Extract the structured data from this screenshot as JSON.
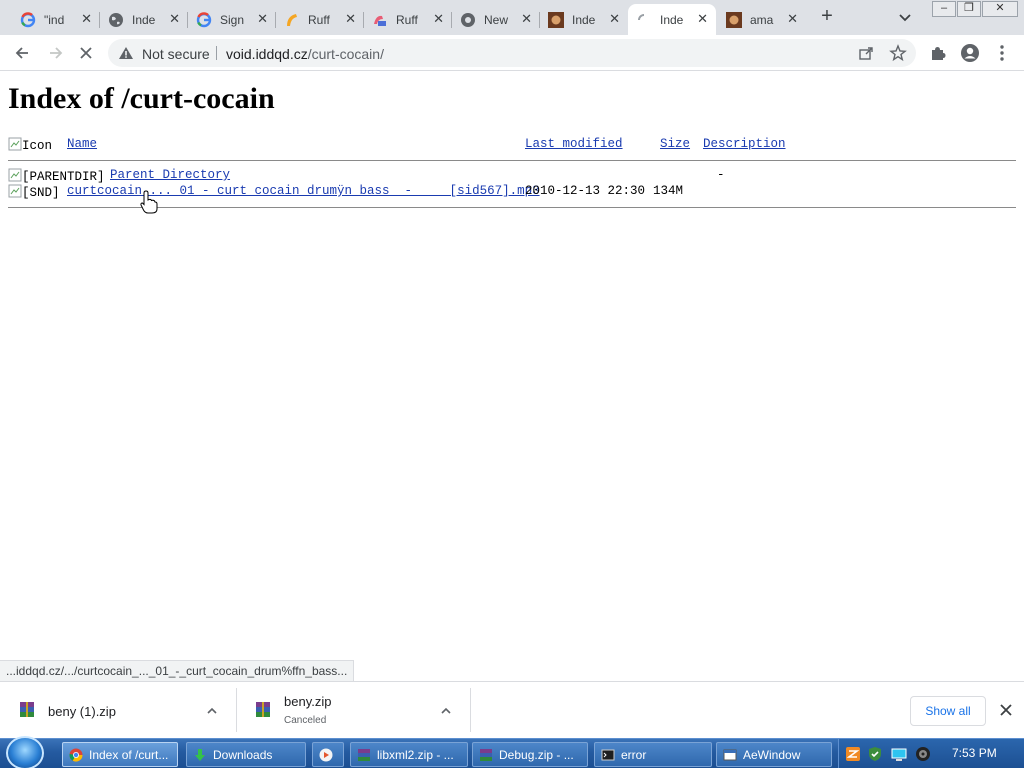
{
  "browser": {
    "tabs": [
      {
        "title": "\"ind",
        "icon": "google-icon"
      },
      {
        "title": "Inde",
        "icon": "globe-icon"
      },
      {
        "title": "Sign",
        "icon": "google-icon"
      },
      {
        "title": "Ruff",
        "icon": "ruffle-icon"
      },
      {
        "title": "Ruff",
        "icon": "ruffle-icon"
      },
      {
        "title": "New",
        "icon": "chrome-icon"
      },
      {
        "title": "Inde",
        "icon": "avatar-icon"
      },
      {
        "title": "Inde",
        "icon": "loading-spinner-icon",
        "active": true
      },
      {
        "title": "ama",
        "icon": "avatar-icon"
      }
    ],
    "security_label": "Not secure",
    "url_host": "void.iddqd.cz",
    "url_path": "/curt-cocain/"
  },
  "page": {
    "heading": "Index of /curt-cocain",
    "columns": {
      "icon_alt": "Icon",
      "name": "Name",
      "last_modified": "Last modified",
      "size": "Size",
      "description": "Description"
    },
    "rows": [
      {
        "icon_alt": "[PARENTDIR]",
        "name": "Parent Directory",
        "modified": "",
        "size": "-",
        "description": ""
      },
      {
        "icon_alt": "[SND]",
        "name": "curtcocain_..._01_-_curt_cocain_drumÿn_bass__-_____[sid567].mp3",
        "modified": "2010-12-13 22:30",
        "size": "134M",
        "description": ""
      }
    ]
  },
  "status_bar": "...iddqd.cz/.../curtcocain_..._01_-_curt_cocain_drum%ffn_bass...",
  "downloads": {
    "items": [
      {
        "name": "beny (1).zip",
        "status": ""
      },
      {
        "name": "beny.zip",
        "status": "Canceled"
      }
    ],
    "show_all": "Show all"
  },
  "taskbar": {
    "tasks": [
      {
        "label": "Index of /curt...",
        "icon": "chrome-icon",
        "active": true
      },
      {
        "label": "Downloads",
        "icon": "downloads-icon"
      },
      {
        "label": "",
        "icon": "media-player-icon"
      },
      {
        "label": "libxml2.zip - ...",
        "icon": "winrar-icon"
      },
      {
        "label": "Debug.zip - ...",
        "icon": "winrar-icon"
      },
      {
        "label": "error",
        "icon": "console-icon"
      },
      {
        "label": "AeWindow",
        "icon": "window-icon"
      }
    ],
    "clock": "7:53 PM"
  }
}
